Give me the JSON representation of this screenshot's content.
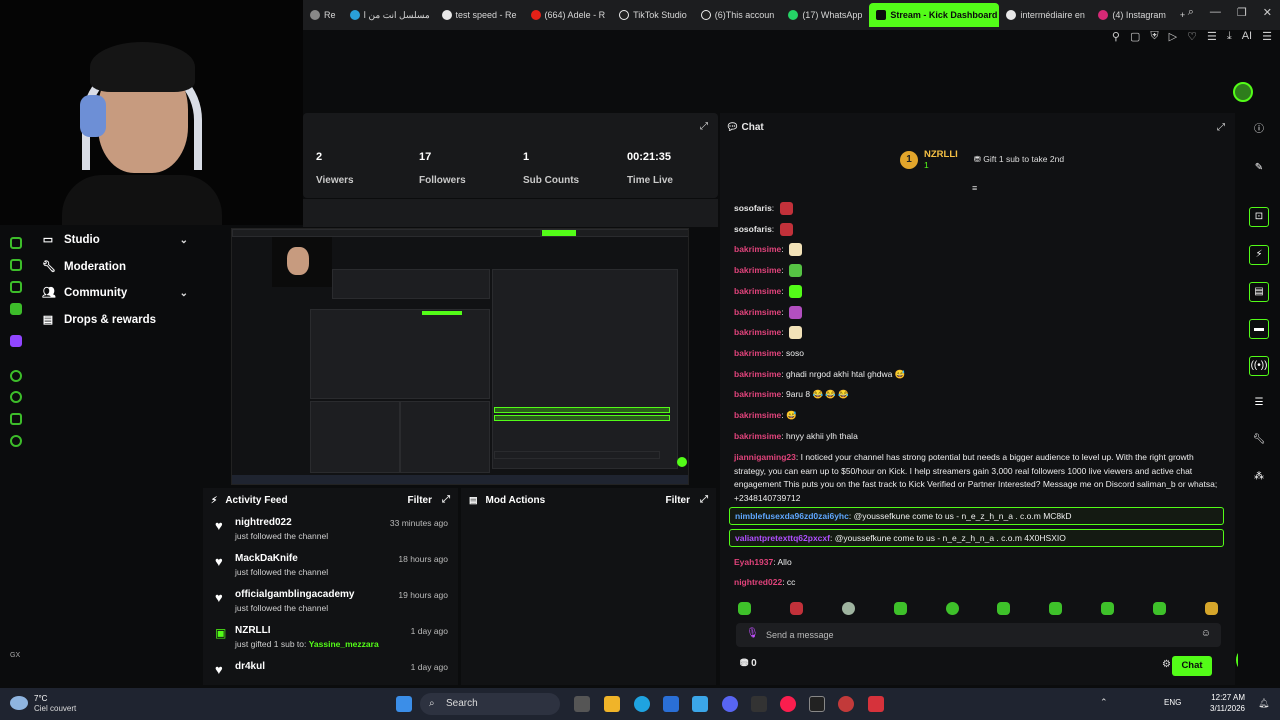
{
  "browser": {
    "tabs": [
      {
        "label": "Re"
      },
      {
        "label": "مسلسل انت من ا"
      },
      {
        "label": "test speed - Re"
      },
      {
        "label": "(664) Adele - R"
      },
      {
        "label": "TikTok Studio"
      },
      {
        "label": "(6)This accoun"
      },
      {
        "label": "(17) WhatsApp"
      },
      {
        "label": "Stream - Kick Dashboard",
        "active": true
      },
      {
        "label": "intermédiaire en"
      },
      {
        "label": "(4) Instagram"
      }
    ],
    "new_tab": "+",
    "ai_label": "AI"
  },
  "nav": {
    "items": [
      {
        "label": "Studio",
        "icon": "monitor-icon",
        "chevron": "⌄"
      },
      {
        "label": "Moderation",
        "icon": "wrench-icon"
      },
      {
        "label": "Community",
        "icon": "people-icon",
        "chevron": "⌄"
      },
      {
        "label": "Drops & rewards",
        "icon": "gift-icon"
      }
    ],
    "rail_label": "GX"
  },
  "stats": [
    {
      "value": "2",
      "label": "Viewers"
    },
    {
      "value": "17",
      "label": "Followers"
    },
    {
      "value": "1",
      "label": "Sub Counts"
    },
    {
      "value": "00:21:35",
      "label": "Time Live"
    }
  ],
  "activity": {
    "title": "Activity Feed",
    "filter": "Filter",
    "items": [
      {
        "name": "nightred022",
        "desc": "just followed the channel",
        "time": "33 minutes ago",
        "type": "follow"
      },
      {
        "name": "MackDaKnife",
        "desc": "just followed the channel",
        "time": "18 hours ago",
        "type": "follow"
      },
      {
        "name": "officialgamblingacademy",
        "desc": "just followed the channel",
        "time": "19 hours ago",
        "type": "follow"
      },
      {
        "name": "NZRLLI",
        "desc_prefix": "just gifted ",
        "desc_count": "1",
        "desc_mid": " sub to: ",
        "desc_target": "Yassine_mezzara",
        "time": "1 day ago",
        "type": "gift"
      },
      {
        "name": "dr4kul",
        "desc": "",
        "time": "1 day ago",
        "type": "follow"
      }
    ]
  },
  "mod_actions": {
    "title": "Mod Actions",
    "filter": "Filter"
  },
  "chat": {
    "title": "Chat",
    "pinned": {
      "badge": "1",
      "name": "NZRLLI",
      "count": "1",
      "gift_label": "Gift 1 sub to take 2nd"
    },
    "messages": [
      {
        "user": "sosofaris",
        "text": "",
        "color": "#e6e6e6",
        "emote": "#c2313a"
      },
      {
        "user": "sosofaris",
        "text": "",
        "color": "#e6e6e6",
        "emote": "#c2313a"
      },
      {
        "user": "bakrimsime",
        "text": "",
        "color": "#e0437b",
        "emote": "#f2e2b8"
      },
      {
        "user": "bakrimsime",
        "text": "",
        "color": "#e0437b",
        "emote": "#56c344"
      },
      {
        "user": "bakrimsime",
        "text": "",
        "color": "#e0437b",
        "emote": "#53fc18"
      },
      {
        "user": "bakrimsime",
        "text": "",
        "color": "#e0437b",
        "emote": "#b24fc0"
      },
      {
        "user": "bakrimsime",
        "text": "",
        "color": "#e0437b",
        "emote": "#f2e2b8"
      },
      {
        "user": "bakrimsime",
        "text": "soso",
        "color": "#e0437b"
      },
      {
        "user": "bakrimsime",
        "text": "ghadi nrgod akhi htal ghdwa 😅",
        "color": "#e0437b"
      },
      {
        "user": "bakrimsime",
        "text": "9aru 8 😂 😂 😂",
        "color": "#e0437b"
      },
      {
        "user": "bakrimsime",
        "text": "😅",
        "color": "#e0437b"
      },
      {
        "user": "bakrimsime",
        "text": "hnyy akhii ylh thala",
        "color": "#e0437b"
      },
      {
        "user": "jiannigaming23",
        "text": "I noticed your channel has strong potential but needs a bigger audience to level up. With the right growth strategy, you can earn up to $50/hour on Kick. I help streamers gain 3,000 real followers 1000 live viewers and active chat engagement This puts you on the fast track to Kick Verified or Partner Interested? Message me on Discord saliman_b or whatsa; +2348140739712",
        "color": "#e0437b"
      },
      {
        "user": "nimblefusexda96zd0zai6yhc",
        "text": "@youssefkune come to us - n_e_z_h_n_a . c.o.m MC8kD",
        "color": "#5fa8ff",
        "highlight": true
      },
      {
        "user": "valiantpretexttq62pxcxf",
        "text": "@youssefkune come to us - n_e_z_h_n_a . c.o.m 4X0HSXIO",
        "color": "#b04fff",
        "highlight": true
      },
      {
        "user": "Eyah1937",
        "text": "Allo",
        "color": "#e0437b"
      },
      {
        "user": "nightred022",
        "text": "cc",
        "color": "#e0437b"
      }
    ],
    "input_placeholder": "Send a message",
    "points": "0",
    "send_label": "Chat"
  },
  "taskbar": {
    "weather_temp": "7°C",
    "weather_desc": "Ciel couvert",
    "search_placeholder": "Search",
    "lang": "ENG",
    "time": "12:27 AM",
    "date": "3/11/2026"
  }
}
